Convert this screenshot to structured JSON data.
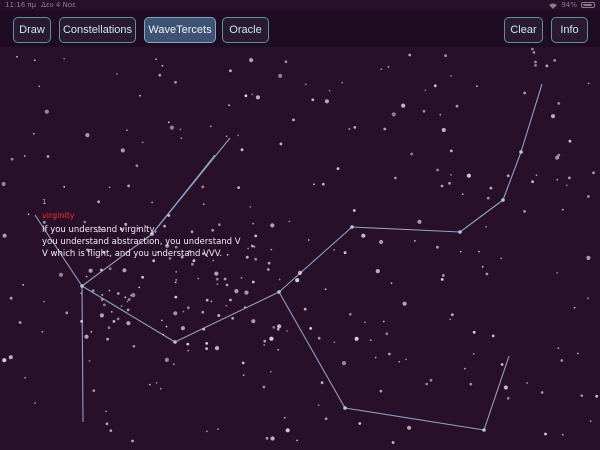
{
  "status_bar": {
    "time": "11:16 πμ",
    "date": "Δευ 4 Νοε",
    "battery": "94%",
    "battery_level": 0.94
  },
  "toolbar": {
    "left_buttons": [
      {
        "label": "Draw",
        "active": false
      },
      {
        "label": "Constellations",
        "active": false
      },
      {
        "label": "WaveTercets",
        "active": true
      },
      {
        "label": "Oracle",
        "active": false
      }
    ],
    "right_buttons": [
      {
        "label": "Clear"
      },
      {
        "label": "Info"
      }
    ]
  },
  "poem": {
    "number": "1",
    "title": "virginity",
    "lines": [
      "If you understand virginity,",
      "you understand abstraction, you understand V",
      "V which is flight, and you understand VVV."
    ]
  },
  "colors": {
    "background": "#280f2a",
    "toolbar": "#200c22",
    "button_border": "#5f8ea8",
    "active_button": "#3f5273",
    "star": "#d9d0e2",
    "line": "#8ea0c4",
    "title": "#ff2d2d"
  }
}
